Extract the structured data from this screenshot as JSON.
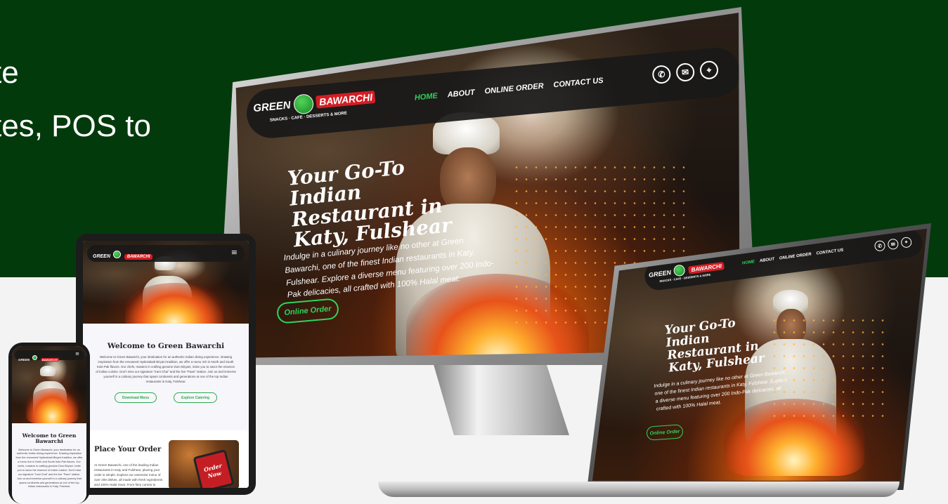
{
  "headline": {
    "line1": "te",
    "line2": "tes, POS to"
  },
  "brand": {
    "logo_left": "GREEN",
    "logo_right": "BAWARCHI",
    "tagline": "SNACKS · CAFE · DESSERTS & MORE"
  },
  "nav": {
    "items": [
      "HOME",
      "ABOUT",
      "ONLINE ORDER",
      "CONTACT US"
    ],
    "active": "HOME"
  },
  "contact_icons": [
    "phone-icon",
    "mail-icon",
    "location-pin-icon"
  ],
  "hero": {
    "title": "Your Go-To Indian Restaurant in Katy, Fulshear",
    "text": "Indulge in a culinary journey like no other at Green Bawarchi, one of the finest Indian restaurants in Katy, Fulshear. Explore a diverse menu featuring over 200 Indo-Pak delicacies, all crafted with 100% Halal meat.",
    "button": "Online Order"
  },
  "welcome": {
    "title": "Welcome to Green Bawarchi",
    "text": "Welcome to Green Bawarchi, your destination for an authentic Indian dining experience. Drawing inspiration from the renowned Hyderabadi Biryani tradition, we offer a menu rich in North and South Indo-Pak flavors. Our chefs, masters in crafting genuine Dum Biryani, invite you to savor the essence of Indian cuisine. Don't miss our signature \"Irani Chai\" and the live \"Paan\" station. Join us and immerse yourself in a culinary journey that spans continents and generations at one of the top Indian restaurants in Katy, Fulshear.",
    "btn_menu": "Download Menu",
    "btn_catering": "Explore Catering"
  },
  "order": {
    "title": "Place Your Order",
    "text": "At Green Bawarchi, one of the leading Indian restaurants in Katy and Fulshear, placing your order is simple. Explore our extensive menu of over 200 dishes, all made with fresh ingredients and 100% Halal meat. From fiery curries to flavorful biryanis, we have something",
    "image_text": "Order Now"
  },
  "colors": {
    "bg_dark_green": "#033a0c",
    "accent_green": "#2fd45a",
    "logo_red": "#d41d24"
  }
}
